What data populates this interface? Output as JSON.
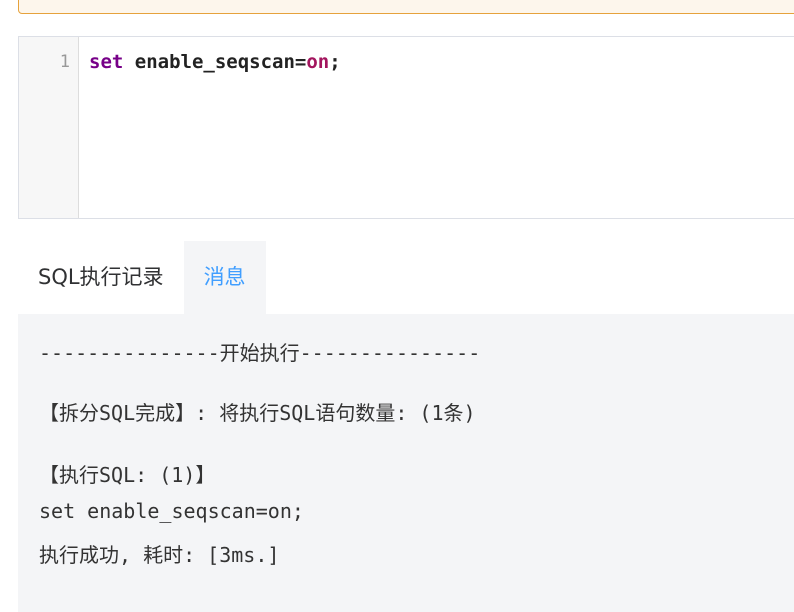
{
  "editor": {
    "line_number": "1",
    "code": {
      "keyword": "set",
      "middle": " enable_seqscan=",
      "value": "on",
      "end": ";"
    }
  },
  "tabs": [
    {
      "label": "SQL执行记录",
      "active": false
    },
    {
      "label": "消息",
      "active": true
    }
  ],
  "messages": {
    "start_line": "---------------开始执行---------------",
    "split_line": "【拆分SQL完成】: 将执行SQL语句数量: (1条)",
    "exec_header": "【执行SQL: (1)】",
    "exec_sql": "set enable_seqscan=on;",
    "exec_result": "执行成功, 耗时: [3ms.]"
  },
  "colors": {
    "notice_border": "#e6a23c",
    "active_tab": "#409eff",
    "keyword": "#770088",
    "atom": "#a3155e"
  }
}
